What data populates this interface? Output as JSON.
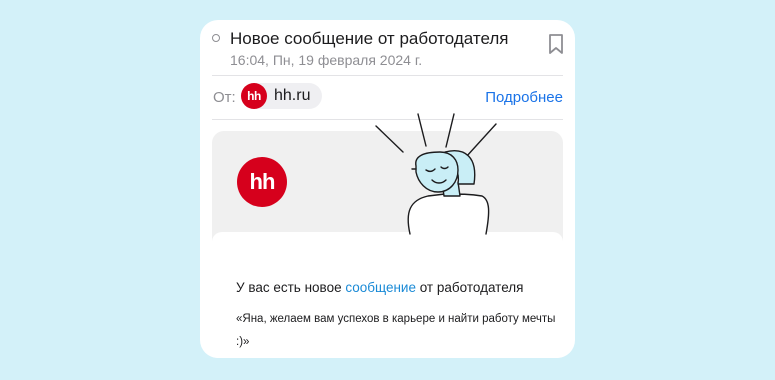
{
  "email": {
    "subject": "Новое сообщение от работодателя",
    "date": "16:04, Пн, 19 февраля 2024 г.",
    "from_label": "От:",
    "sender_name": "hh.ru",
    "sender_avatar_text": "hh",
    "details_link": "Подробнее"
  },
  "banner": {
    "logo_text": "hh"
  },
  "body": {
    "line1_before": "У вас есть новое ",
    "line1_link": "сообщение",
    "line1_after": " от работодателя",
    "quote": "«Яна, желаем вам успехов в карьере и найти работу мечты :)»"
  },
  "colors": {
    "background": "#d3f1f9",
    "brand_red": "#d6001c",
    "link_blue": "#1a73e8",
    "illustration_face": "#c9eef6"
  },
  "icons": [
    "unread-dot-icon",
    "bookmark-icon",
    "hh-logo",
    "person-illustration"
  ]
}
